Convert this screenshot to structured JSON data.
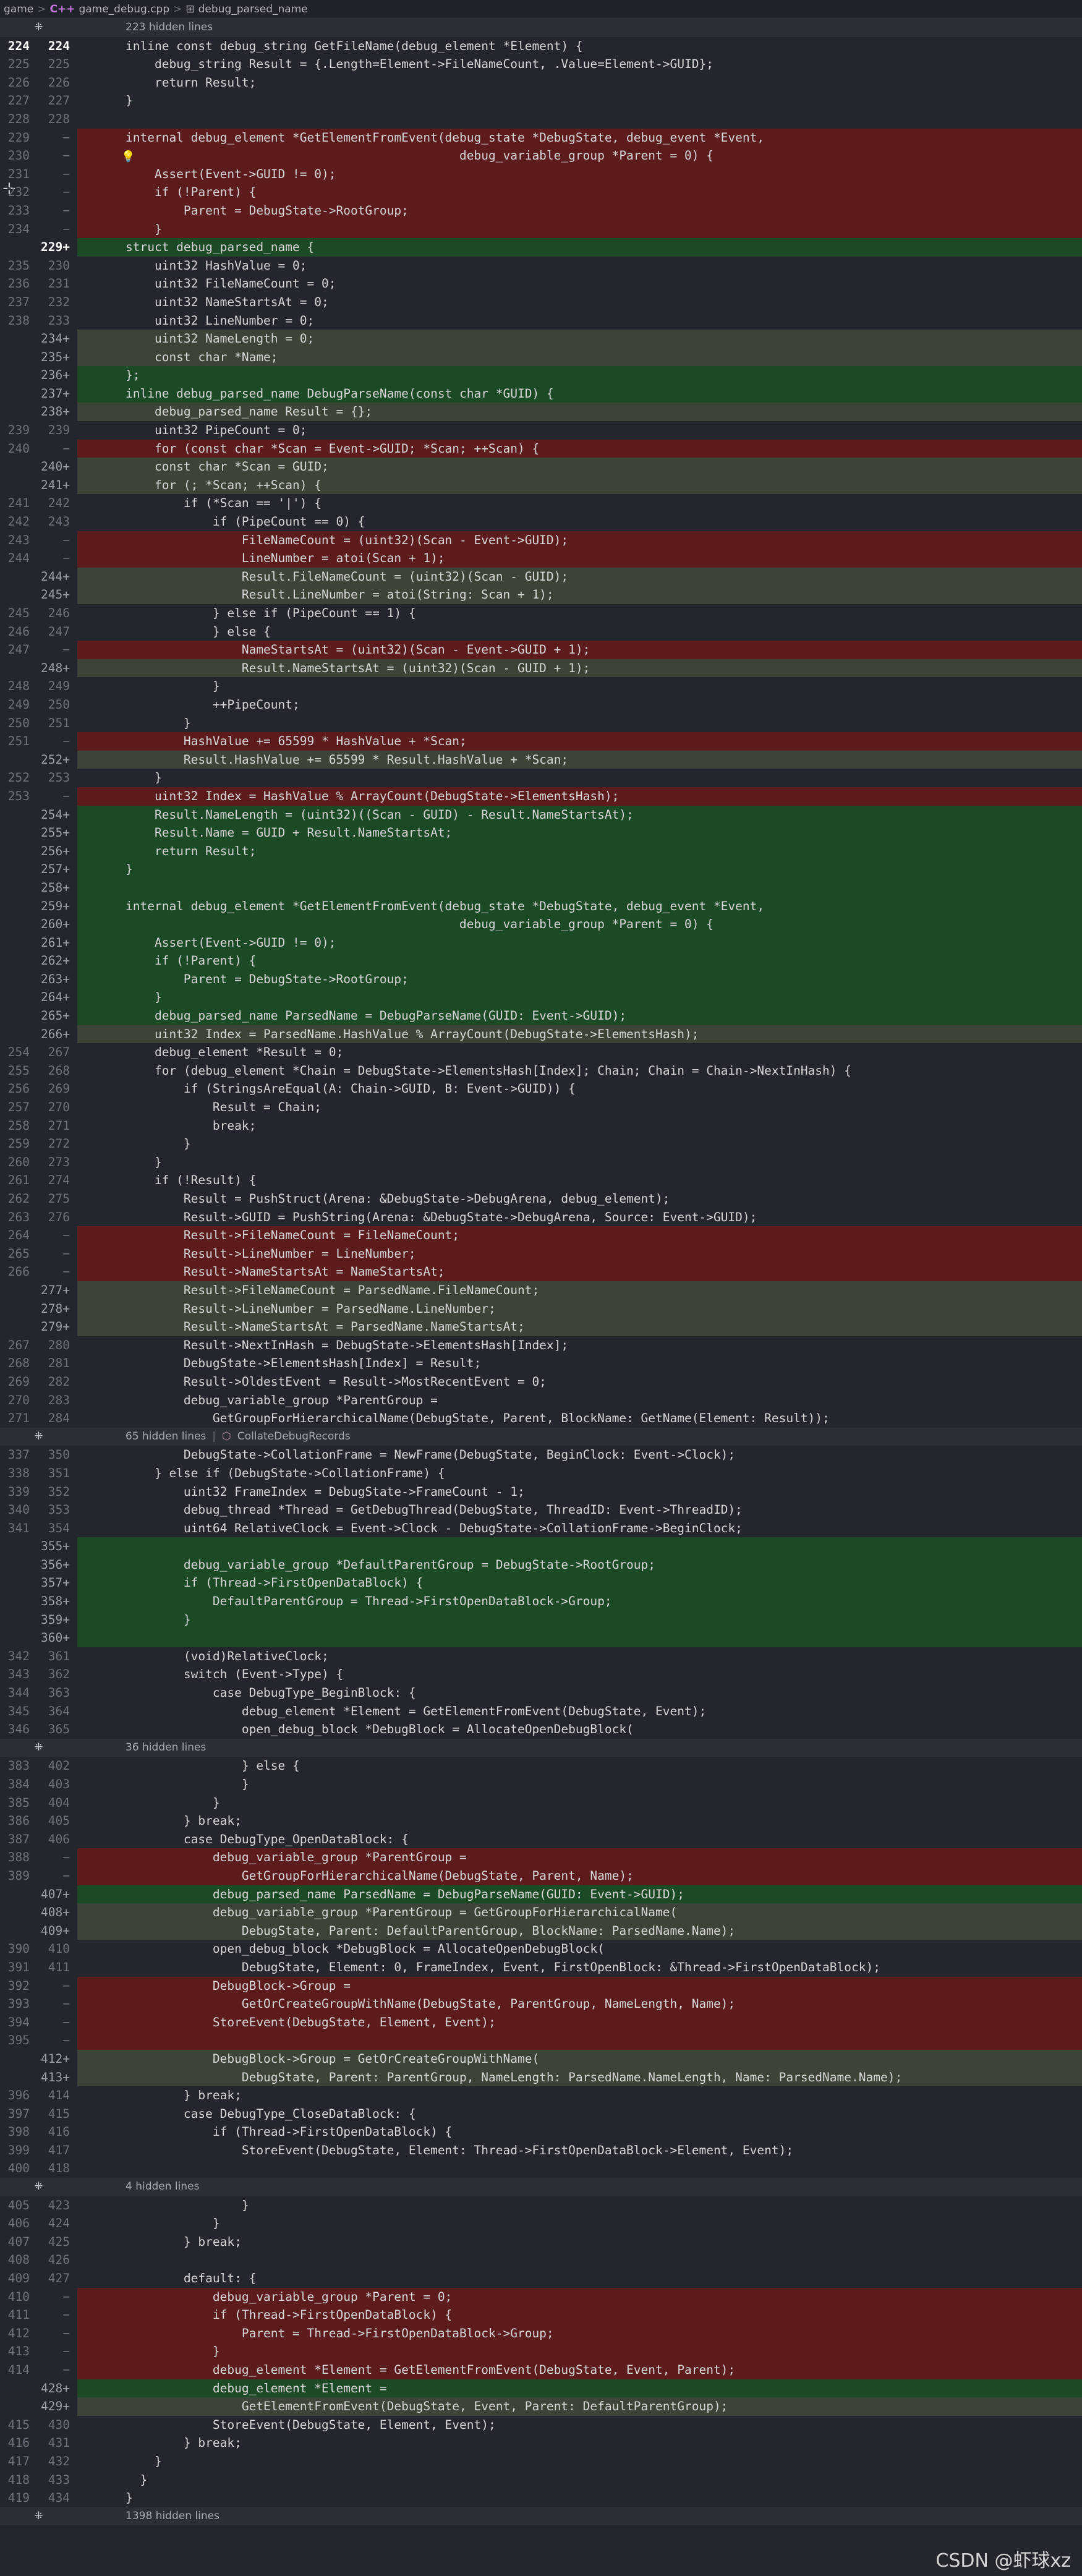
{
  "breadcrumb": {
    "items": [
      "game",
      "game_debug.cpp",
      "debug_parsed_name"
    ],
    "separator": ">",
    "file_icon": "C++",
    "struct_icon": "struct-icon"
  },
  "watermark": "CSDN @虾球xz",
  "hidden_expand_icon": "⁜",
  "rows": [
    {
      "t": "hidden",
      "text": "223 hidden lines"
    },
    {
      "t": "ctx",
      "o": "224",
      "n": "224",
      "c": "inline const debug_string GetFileName(debug_element *Element) {",
      "sel": true
    },
    {
      "t": "ctx",
      "o": "225",
      "n": "225",
      "c": "    debug_string Result = {.Length=Element->FileNameCount, .Value=Element->GUID};"
    },
    {
      "t": "ctx",
      "o": "226",
      "n": "226",
      "c": "    return Result;"
    },
    {
      "t": "ctx",
      "o": "227",
      "n": "227",
      "c": "}"
    },
    {
      "t": "ctx",
      "o": "228",
      "n": "228",
      "c": ""
    },
    {
      "t": "del",
      "o": "229",
      "n": "−",
      "c": "internal debug_element *GetElementFromEvent(debug_state *DebugState, debug_event *Event,"
    },
    {
      "t": "del",
      "o": "230",
      "n": "−",
      "c": "                                              debug_variable_group *Parent = 0) {",
      "bulb": true
    },
    {
      "t": "del",
      "o": "231",
      "n": "−",
      "c": "    Assert(Event->GUID != 0);"
    },
    {
      "t": "del",
      "o": "232",
      "n": "−",
      "c": "    if (!Parent) {"
    },
    {
      "t": "del",
      "o": "233",
      "n": "−",
      "c": "        Parent = DebugState->RootGroup;"
    },
    {
      "t": "del",
      "o": "234",
      "n": "−",
      "c": "    }"
    },
    {
      "t": "add",
      "o": "",
      "n": "229+",
      "c": "struct debug_parsed_name {",
      "sel": true
    },
    {
      "t": "ctx",
      "o": "235",
      "n": "230",
      "c": "    uint32 HashValue = 0;"
    },
    {
      "t": "ctx",
      "o": "236",
      "n": "231",
      "c": "    uint32 FileNameCount = 0;"
    },
    {
      "t": "ctx",
      "o": "237",
      "n": "232",
      "c": "    uint32 NameStartsAt = 0;"
    },
    {
      "t": "ctx",
      "o": "238",
      "n": "233",
      "c": "    uint32 LineNumber = 0;"
    },
    {
      "t": "mod",
      "o": "",
      "n": "234+",
      "c": "    uint32 NameLength = 0;"
    },
    {
      "t": "mod",
      "o": "",
      "n": "235+",
      "c": "    const char *Name;"
    },
    {
      "t": "add",
      "o": "",
      "n": "236+",
      "c": "};"
    },
    {
      "t": "add",
      "o": "",
      "n": "237+",
      "c": "inline debug_parsed_name DebugParseName(const char *GUID) {"
    },
    {
      "t": "mod",
      "o": "",
      "n": "238+",
      "c": "    debug_parsed_name Result = {};"
    },
    {
      "t": "ctx",
      "o": "239",
      "n": "239",
      "c": "    uint32 PipeCount = 0;"
    },
    {
      "t": "del",
      "o": "240",
      "n": "−",
      "c": "    for (const char *Scan = Event->GUID; *Scan; ++Scan) {"
    },
    {
      "t": "mod",
      "o": "",
      "n": "240+",
      "c": "    const char *Scan = GUID;"
    },
    {
      "t": "mod",
      "o": "",
      "n": "241+",
      "c": "    for (; *Scan; ++Scan) {"
    },
    {
      "t": "ctx",
      "o": "241",
      "n": "242",
      "c": "        if (*Scan == '|') {"
    },
    {
      "t": "ctx",
      "o": "242",
      "n": "243",
      "c": "            if (PipeCount == 0) {"
    },
    {
      "t": "del",
      "o": "243",
      "n": "−",
      "c": "                FileNameCount = (uint32)(Scan - Event->GUID);"
    },
    {
      "t": "del",
      "o": "244",
      "n": "−",
      "c": "                LineNumber = atoi(Scan + 1);"
    },
    {
      "t": "mod",
      "o": "",
      "n": "244+",
      "c": "                Result.FileNameCount = (uint32)(Scan - GUID);"
    },
    {
      "t": "mod",
      "o": "",
      "n": "245+",
      "c": "                Result.LineNumber = atoi(String: Scan + 1);"
    },
    {
      "t": "ctx",
      "o": "245",
      "n": "246",
      "c": "            } else if (PipeCount == 1) {"
    },
    {
      "t": "ctx",
      "o": "246",
      "n": "247",
      "c": "            } else {"
    },
    {
      "t": "del",
      "o": "247",
      "n": "−",
      "c": "                NameStartsAt = (uint32)(Scan - Event->GUID + 1);"
    },
    {
      "t": "mod",
      "o": "",
      "n": "248+",
      "c": "                Result.NameStartsAt = (uint32)(Scan - GUID + 1);"
    },
    {
      "t": "ctx",
      "o": "248",
      "n": "249",
      "c": "            }"
    },
    {
      "t": "ctx",
      "o": "249",
      "n": "250",
      "c": "            ++PipeCount;"
    },
    {
      "t": "ctx",
      "o": "250",
      "n": "251",
      "c": "        }"
    },
    {
      "t": "del",
      "o": "251",
      "n": "−",
      "c": "        HashValue += 65599 * HashValue + *Scan;"
    },
    {
      "t": "mod",
      "o": "",
      "n": "252+",
      "c": "        Result.HashValue += 65599 * Result.HashValue + *Scan;"
    },
    {
      "t": "ctx",
      "o": "252",
      "n": "253",
      "c": "    }"
    },
    {
      "t": "del",
      "o": "253",
      "n": "−",
      "c": "    uint32 Index = HashValue % ArrayCount(DebugState->ElementsHash);"
    },
    {
      "t": "add",
      "o": "",
      "n": "254+",
      "c": "    Result.NameLength = (uint32)((Scan - GUID) - Result.NameStartsAt);"
    },
    {
      "t": "add",
      "o": "",
      "n": "255+",
      "c": "    Result.Name = GUID + Result.NameStartsAt;"
    },
    {
      "t": "add",
      "o": "",
      "n": "256+",
      "c": "    return Result;"
    },
    {
      "t": "add",
      "o": "",
      "n": "257+",
      "c": "}"
    },
    {
      "t": "add",
      "o": "",
      "n": "258+",
      "c": ""
    },
    {
      "t": "add",
      "o": "",
      "n": "259+",
      "c": "internal debug_element *GetElementFromEvent(debug_state *DebugState, debug_event *Event,"
    },
    {
      "t": "add",
      "o": "",
      "n": "260+",
      "c": "                                              debug_variable_group *Parent = 0) {"
    },
    {
      "t": "add",
      "o": "",
      "n": "261+",
      "c": "    Assert(Event->GUID != 0);"
    },
    {
      "t": "add",
      "o": "",
      "n": "262+",
      "c": "    if (!Parent) {"
    },
    {
      "t": "add",
      "o": "",
      "n": "263+",
      "c": "        Parent = DebugState->RootGroup;"
    },
    {
      "t": "add",
      "o": "",
      "n": "264+",
      "c": "    }"
    },
    {
      "t": "add",
      "o": "",
      "n": "265+",
      "c": "    debug_parsed_name ParsedName = DebugParseName(GUID: Event->GUID);"
    },
    {
      "t": "mod",
      "o": "",
      "n": "266+",
      "c": "    uint32 Index = ParsedName.HashValue % ArrayCount(DebugState->ElementsHash);"
    },
    {
      "t": "ctx",
      "o": "254",
      "n": "267",
      "c": "    debug_element *Result = 0;"
    },
    {
      "t": "ctx",
      "o": "255",
      "n": "268",
      "c": "    for (debug_element *Chain = DebugState->ElementsHash[Index]; Chain; Chain = Chain->NextInHash) {"
    },
    {
      "t": "ctx",
      "o": "256",
      "n": "269",
      "c": "        if (StringsAreEqual(A: Chain->GUID, B: Event->GUID)) {"
    },
    {
      "t": "ctx",
      "o": "257",
      "n": "270",
      "c": "            Result = Chain;"
    },
    {
      "t": "ctx",
      "o": "258",
      "n": "271",
      "c": "            break;"
    },
    {
      "t": "ctx",
      "o": "259",
      "n": "272",
      "c": "        }"
    },
    {
      "t": "ctx",
      "o": "260",
      "n": "273",
      "c": "    }"
    },
    {
      "t": "ctx",
      "o": "261",
      "n": "274",
      "c": "    if (!Result) {"
    },
    {
      "t": "ctx",
      "o": "262",
      "n": "275",
      "c": "        Result = PushStruct(Arena: &DebugState->DebugArena, debug_element);"
    },
    {
      "t": "ctx",
      "o": "263",
      "n": "276",
      "c": "        Result->GUID = PushString(Arena: &DebugState->DebugArena, Source: Event->GUID);"
    },
    {
      "t": "del",
      "o": "264",
      "n": "−",
      "c": "        Result->FileNameCount = FileNameCount;"
    },
    {
      "t": "del",
      "o": "265",
      "n": "−",
      "c": "        Result->LineNumber = LineNumber;"
    },
    {
      "t": "del",
      "o": "266",
      "n": "−",
      "c": "        Result->NameStartsAt = NameStartsAt;"
    },
    {
      "t": "mod",
      "o": "",
      "n": "277+",
      "c": "        Result->FileNameCount = ParsedName.FileNameCount;"
    },
    {
      "t": "mod",
      "o": "",
      "n": "278+",
      "c": "        Result->LineNumber = ParsedName.LineNumber;"
    },
    {
      "t": "mod",
      "o": "",
      "n": "279+",
      "c": "        Result->NameStartsAt = ParsedName.NameStartsAt;"
    },
    {
      "t": "ctx",
      "o": "267",
      "n": "280",
      "c": "        Result->NextInHash = DebugState->ElementsHash[Index];"
    },
    {
      "t": "ctx",
      "o": "268",
      "n": "281",
      "c": "        DebugState->ElementsHash[Index] = Result;"
    },
    {
      "t": "ctx",
      "o": "269",
      "n": "282",
      "c": "        Result->OldestEvent = Result->MostRecentEvent = 0;"
    },
    {
      "t": "ctx",
      "o": "270",
      "n": "283",
      "c": "        debug_variable_group *ParentGroup ="
    },
    {
      "t": "ctx",
      "o": "271",
      "n": "284",
      "c": "            GetGroupForHierarchicalName(DebugState, Parent, BlockName: GetName(Element: Result));"
    },
    {
      "t": "hidden",
      "text": "65 hidden lines",
      "ctx": "CollateDebugRecords"
    },
    {
      "t": "ctx",
      "o": "337",
      "n": "350",
      "c": "        DebugState->CollationFrame = NewFrame(DebugState, BeginClock: Event->Clock);"
    },
    {
      "t": "ctx",
      "o": "338",
      "n": "351",
      "c": "    } else if (DebugState->CollationFrame) {"
    },
    {
      "t": "ctx",
      "o": "339",
      "n": "352",
      "c": "        uint32 FrameIndex = DebugState->FrameCount - 1;"
    },
    {
      "t": "ctx",
      "o": "340",
      "n": "353",
      "c": "        debug_thread *Thread = GetDebugThread(DebugState, ThreadID: Event->ThreadID);"
    },
    {
      "t": "ctx",
      "o": "341",
      "n": "354",
      "c": "        uint64 RelativeClock = Event->Clock - DebugState->CollationFrame->BeginClock;"
    },
    {
      "t": "add",
      "o": "",
      "n": "355+",
      "c": ""
    },
    {
      "t": "add",
      "o": "",
      "n": "356+",
      "c": "        debug_variable_group *DefaultParentGroup = DebugState->RootGroup;"
    },
    {
      "t": "add",
      "o": "",
      "n": "357+",
      "c": "        if (Thread->FirstOpenDataBlock) {"
    },
    {
      "t": "add",
      "o": "",
      "n": "358+",
      "c": "            DefaultParentGroup = Thread->FirstOpenDataBlock->Group;"
    },
    {
      "t": "add",
      "o": "",
      "n": "359+",
      "c": "        }"
    },
    {
      "t": "add",
      "o": "",
      "n": "360+",
      "c": ""
    },
    {
      "t": "ctx",
      "o": "342",
      "n": "361",
      "c": "        (void)RelativeClock;"
    },
    {
      "t": "ctx",
      "o": "343",
      "n": "362",
      "c": "        switch (Event->Type) {"
    },
    {
      "t": "ctx",
      "o": "344",
      "n": "363",
      "c": "            case DebugType_BeginBlock: {"
    },
    {
      "t": "ctx",
      "o": "345",
      "n": "364",
      "c": "                debug_element *Element = GetElementFromEvent(DebugState, Event);"
    },
    {
      "t": "ctx",
      "o": "346",
      "n": "365",
      "c": "                open_debug_block *DebugBlock = AllocateOpenDebugBlock("
    },
    {
      "t": "hidden",
      "text": "36 hidden lines"
    },
    {
      "t": "ctx",
      "o": "383",
      "n": "402",
      "c": "                } else {"
    },
    {
      "t": "ctx",
      "o": "384",
      "n": "403",
      "c": "                }"
    },
    {
      "t": "ctx",
      "o": "385",
      "n": "404",
      "c": "            }"
    },
    {
      "t": "ctx",
      "o": "386",
      "n": "405",
      "c": "        } break;"
    },
    {
      "t": "ctx",
      "o": "387",
      "n": "406",
      "c": "        case DebugType_OpenDataBlock: {"
    },
    {
      "t": "del",
      "o": "388",
      "n": "−",
      "c": "            debug_variable_group *ParentGroup ="
    },
    {
      "t": "del",
      "o": "389",
      "n": "−",
      "c": "                GetGroupForHierarchicalName(DebugState, Parent, Name);"
    },
    {
      "t": "add",
      "o": "",
      "n": "407+",
      "c": "            debug_parsed_name ParsedName = DebugParseName(GUID: Event->GUID);"
    },
    {
      "t": "mod",
      "o": "",
      "n": "408+",
      "c": "            debug_variable_group *ParentGroup = GetGroupForHierarchicalName("
    },
    {
      "t": "mod",
      "o": "",
      "n": "409+",
      "c": "                DebugState, Parent: DefaultParentGroup, BlockName: ParsedName.Name);"
    },
    {
      "t": "ctx",
      "o": "390",
      "n": "410",
      "c": "            open_debug_block *DebugBlock = AllocateOpenDebugBlock("
    },
    {
      "t": "ctx",
      "o": "391",
      "n": "411",
      "c": "                DebugState, Element: 0, FrameIndex, Event, FirstOpenBlock: &Thread->FirstOpenDataBlock);"
    },
    {
      "t": "del",
      "o": "392",
      "n": "−",
      "c": "            DebugBlock->Group ="
    },
    {
      "t": "del",
      "o": "393",
      "n": "−",
      "c": "                GetOrCreateGroupWithName(DebugState, ParentGroup, NameLength, Name);"
    },
    {
      "t": "del",
      "o": "394",
      "n": "−",
      "c": "            StoreEvent(DebugState, Element, Event);"
    },
    {
      "t": "del",
      "o": "395",
      "n": "−",
      "c": ""
    },
    {
      "t": "mod",
      "o": "",
      "n": "412+",
      "c": "            DebugBlock->Group = GetOrCreateGroupWithName("
    },
    {
      "t": "mod",
      "o": "",
      "n": "413+",
      "c": "                DebugState, Parent: ParentGroup, NameLength: ParsedName.NameLength, Name: ParsedName.Name);"
    },
    {
      "t": "ctx",
      "o": "396",
      "n": "414",
      "c": "        } break;"
    },
    {
      "t": "ctx",
      "o": "397",
      "n": "415",
      "c": "        case DebugType_CloseDataBlock: {"
    },
    {
      "t": "ctx",
      "o": "398",
      "n": "416",
      "c": "            if (Thread->FirstOpenDataBlock) {"
    },
    {
      "t": "ctx",
      "o": "399",
      "n": "417",
      "c": "                StoreEvent(DebugState, Element: Thread->FirstOpenDataBlock->Element, Event);"
    },
    {
      "t": "ctx",
      "o": "400",
      "n": "418",
      "c": ""
    },
    {
      "t": "hidden",
      "text": "4 hidden lines"
    },
    {
      "t": "ctx",
      "o": "405",
      "n": "423",
      "c": "                }"
    },
    {
      "t": "ctx",
      "o": "406",
      "n": "424",
      "c": "            }"
    },
    {
      "t": "ctx",
      "o": "407",
      "n": "425",
      "c": "        } break;"
    },
    {
      "t": "ctx",
      "o": "408",
      "n": "426",
      "c": ""
    },
    {
      "t": "ctx",
      "o": "409",
      "n": "427",
      "c": "        default: {"
    },
    {
      "t": "del",
      "o": "410",
      "n": "−",
      "c": "            debug_variable_group *Parent = 0;"
    },
    {
      "t": "del",
      "o": "411",
      "n": "−",
      "c": "            if (Thread->FirstOpenDataBlock) {"
    },
    {
      "t": "del",
      "o": "412",
      "n": "−",
      "c": "                Parent = Thread->FirstOpenDataBlock->Group;"
    },
    {
      "t": "del",
      "o": "413",
      "n": "−",
      "c": "            }"
    },
    {
      "t": "ctx",
      "o": "414",
      "n": "−",
      "c": "            debug_element *Element = GetElementFromEvent(DebugState, Event, Parent);",
      "delbg": true
    },
    {
      "t": "add",
      "o": "",
      "n": "428+",
      "c": "            debug_element *Element ="
    },
    {
      "t": "mod",
      "o": "",
      "n": "429+",
      "c": "                GetElementFromEvent(DebugState, Event, Parent: DefaultParentGroup);"
    },
    {
      "t": "ctx",
      "o": "415",
      "n": "430",
      "c": "            StoreEvent(DebugState, Element, Event);"
    },
    {
      "t": "ctx",
      "o": "416",
      "n": "431",
      "c": "        } break;"
    },
    {
      "t": "ctx",
      "o": "417",
      "n": "432",
      "c": "    }"
    },
    {
      "t": "ctx",
      "o": "418",
      "n": "433",
      "c": "  }"
    },
    {
      "t": "ctx",
      "o": "419",
      "n": "434",
      "c": "}"
    },
    {
      "t": "hidden",
      "text": "1398 hidden lines"
    }
  ]
}
